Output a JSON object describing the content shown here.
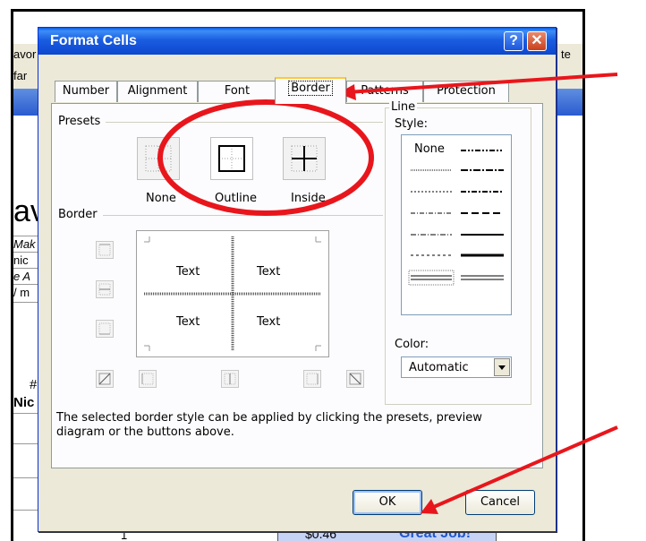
{
  "background": {
    "menu_frag_1": "avor",
    "menu_frag_2": "te",
    "toolbar_frag": "far",
    "sheet_title_frag": "av",
    "rows": [
      "Mak",
      " nic",
      "e A",
      "/ m"
    ],
    "hash": "#",
    "nick_frag": "Nic",
    "row_num": "1",
    "price_cell": "$0.46",
    "great_cell": "Great Job!"
  },
  "dialog": {
    "title": "Format Cells",
    "help_label": "?",
    "close_label": "✕",
    "tabs": [
      "Number",
      "Alignment",
      "Font",
      "Border",
      "Patterns",
      "Protection"
    ],
    "active_tab": "Border",
    "presets": {
      "group_label": "Presets",
      "none_label": "None",
      "outline_label": "Outline",
      "inside_label": "Inside"
    },
    "border": {
      "group_label": "Border",
      "preview_text": [
        "Text",
        "Text",
        "Text",
        "Text"
      ]
    },
    "line": {
      "group_label": "Line",
      "style_label": "Style:",
      "none_option": "None",
      "color_label": "Color:",
      "color_value": "Automatic"
    },
    "hint": "The selected border style can be applied by clicking the presets, preview diagram or the buttons above.",
    "ok_label": "OK",
    "cancel_label": "Cancel"
  },
  "colors": {
    "annotation_red": "#e8161c",
    "title_blue": "#0a5ae8",
    "dialog_bg": "#ece9d8"
  }
}
